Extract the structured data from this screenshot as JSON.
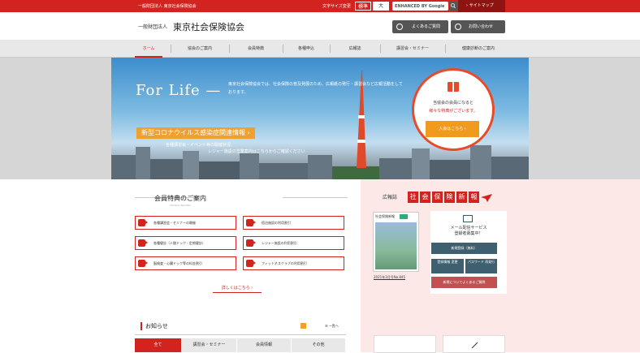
{
  "topbar": {
    "org": "一般財団法人 東京社会保険協会",
    "font_size_label": "文字サイズ変更",
    "font_std": "標準",
    "font_large": "大",
    "search_placeholder": "ENHANCED BY Google",
    "sitemap": "サイトマップ"
  },
  "header": {
    "org_type": "一般財団法人",
    "org_name": "東京社会保険協会",
    "faq": "よくあるご質問",
    "contact": "お問い合わせ"
  },
  "nav": {
    "items": [
      "ホーム",
      "協会のご案内",
      "会員特典",
      "各種申込",
      "広報誌",
      "講習会・セミナー",
      "健康診断のご案内"
    ]
  },
  "hero": {
    "tagline": "For Life —",
    "intro": "東京社会保険協会では、社会保険の普及発展のため、広報紙の発行・講習会など広報活動をしております。",
    "covid_banner": "新型コロナウイルス感染症関連情報 ›",
    "covid_text1": "各種講習会・イベント等の開催状況、",
    "covid_text2": "レジャー施設の営業案内はこちらからご確認ください",
    "member_line1": "当協会の会員になると",
    "member_line2": "様々な特典がございます。",
    "join_button": "入会はこちら ›"
  },
  "benefits": {
    "title": "会員特典のご案内",
    "subtitle": "Member Benefits",
    "cards": [
      "各種講習会・セミナーの開催",
      "宿泊施設の利用割引",
      "各種健診（人間ドック・定期健診）",
      "レジャー施設の利用割引",
      "脳検査・心臓ドック等の料金割引",
      "フィットネスクラブの利用割引"
    ],
    "more": "詳しくはこちら ›"
  },
  "sidebar": {
    "paper_label": "広報誌",
    "paper_name": [
      "社",
      "会",
      "保",
      "険",
      "新",
      "報"
    ],
    "paper_cover_title": "社会保険新報",
    "paper_link": "2021年3月号No.845",
    "mail_title_1": "メール配信サービス",
    "mail_title_2": "登録者募集中！",
    "mail_new": "新規登録（無料）",
    "mail_change": "登録情報 変更",
    "mail_password": "パスワード 再発行",
    "mail_faq": "新規についてよくあるご質問"
  },
  "news": {
    "title": "お知らせ",
    "list_link": "一覧へ",
    "tabs": [
      "全て",
      "講習会・セミナー",
      "会員情報",
      "その他"
    ]
  }
}
